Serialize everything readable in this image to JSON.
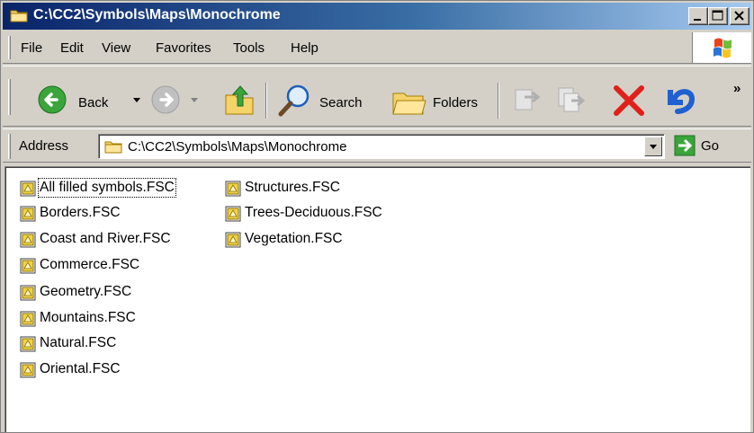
{
  "window": {
    "title": "C:\\CC2\\Symbols\\Maps\\Monochrome"
  },
  "menu": [
    "File",
    "Edit",
    "View",
    "Favorites",
    "Tools",
    "Help"
  ],
  "toolbar": {
    "back_label": "Back",
    "search_label": "Search",
    "folders_label": "Folders",
    "overflow": "»"
  },
  "address": {
    "label": "Address",
    "value": "C:\\CC2\\Symbols\\Maps\\Monochrome",
    "go_label": "Go"
  },
  "files": [
    {
      "name": "All filled symbols.FSC",
      "selected": true
    },
    {
      "name": "Borders.FSC"
    },
    {
      "name": "Coast and River.FSC"
    },
    {
      "name": "Commerce.FSC"
    },
    {
      "name": "Geometry.FSC"
    },
    {
      "name": "Mountains.FSC"
    },
    {
      "name": "Natural.FSC"
    },
    {
      "name": "Oriental.FSC"
    },
    {
      "name": "Structures.FSC"
    },
    {
      "name": "Trees-Deciduous.FSC"
    },
    {
      "name": "Vegetation.FSC"
    }
  ],
  "colors": {
    "titlebar_start": "#0a246a",
    "titlebar_end": "#a6caf0",
    "chrome": "#d4d0c8",
    "back_green": "#3aa53a",
    "delete_red": "#e0201a",
    "undo_blue": "#2060d0"
  },
  "icons": {
    "title": "folder-icon",
    "file": "fsc-file-icon",
    "address": "folder-icon",
    "go": "go-arrow-icon",
    "windows_logo": "windows-logo-icon"
  }
}
